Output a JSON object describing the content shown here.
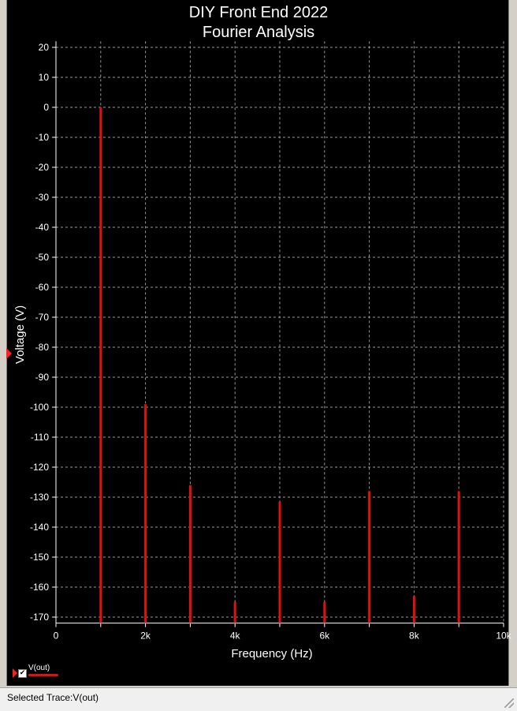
{
  "window": {
    "status_text": "Selected Trace:V(out)"
  },
  "legend": {
    "trace_label": "V(out)",
    "checked": true,
    "trace_color": "#e01010"
  },
  "colors": {
    "background": "#000000",
    "grid": "#9a9a9a",
    "axis_text": "#ffffff",
    "trace": "#e01010"
  },
  "chart_data": {
    "type": "bar",
    "title": "DIY Front End 2022",
    "subtitle": "Fourier Analysis",
    "xlabel": "Frequency (Hz)",
    "ylabel": "Voltage (V)",
    "xlim": [
      0,
      10000
    ],
    "ylim": [
      -172,
      22
    ],
    "x_ticks": [
      0,
      2000,
      4000,
      6000,
      8000,
      10000
    ],
    "x_tick_labels": [
      "0",
      "2k",
      "4k",
      "6k",
      "8k",
      "10k"
    ],
    "x_minor_ticks": [
      1000,
      3000,
      5000,
      7000,
      9000
    ],
    "y_ticks": [
      20,
      10,
      0,
      -10,
      -20,
      -30,
      -40,
      -50,
      -60,
      -70,
      -80,
      -90,
      -100,
      -110,
      -120,
      -130,
      -140,
      -150,
      -160,
      -170
    ],
    "y_tick_labels": [
      "20",
      "10",
      "0",
      "-10",
      "-20",
      "-30",
      "-40",
      "-50",
      "-60",
      "-70",
      "-80",
      "-90",
      "-100",
      "-110",
      "-120",
      "-130",
      "-140",
      "-150",
      "-160",
      "-170"
    ],
    "grid": true,
    "series": [
      {
        "name": "V(out)",
        "x": [
          1000,
          2000,
          3000,
          4000,
          5000,
          6000,
          7000,
          8000,
          9000
        ],
        "values": [
          0,
          -99,
          -126,
          -165,
          -131.5,
          -165,
          -128,
          -163,
          -128
        ]
      }
    ]
  }
}
